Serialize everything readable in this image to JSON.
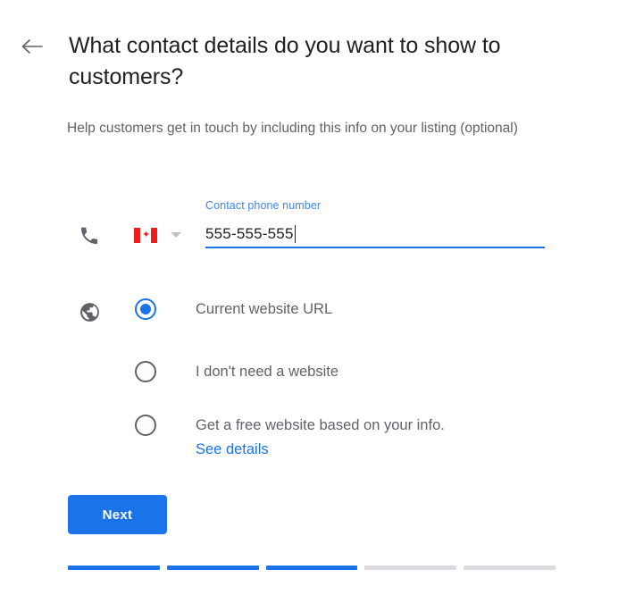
{
  "header": {
    "back_icon": "arrow-left-icon",
    "title": "What contact details do you want to show to customers?",
    "subtitle": "Help customers get in touch by including this info on your listing (optional)"
  },
  "phone_field": {
    "icon": "phone-icon",
    "country_flag": "canada-flag-icon",
    "country_leaf_glyph": "✦",
    "dropdown_icon": "chevron-down-icon",
    "label": "Contact phone number",
    "value": "555-555-555"
  },
  "website_group": {
    "icon": "globe-icon",
    "options": [
      {
        "label": "Current website URL",
        "selected": true
      },
      {
        "label": "I don't need a website",
        "selected": false
      },
      {
        "label": "Get a free website based on your info.",
        "selected": false,
        "link_label": "See details"
      }
    ]
  },
  "actions": {
    "next_label": "Next"
  },
  "progress": {
    "total_steps": 5,
    "completed_steps": 3
  },
  "colors": {
    "accent_blue": "#1a73e8",
    "label_blue": "#4285f4",
    "text_primary": "#202124",
    "text_secondary": "#5f6368",
    "inactive_gray": "#dadce0",
    "flag_red": "#f21c1c"
  }
}
